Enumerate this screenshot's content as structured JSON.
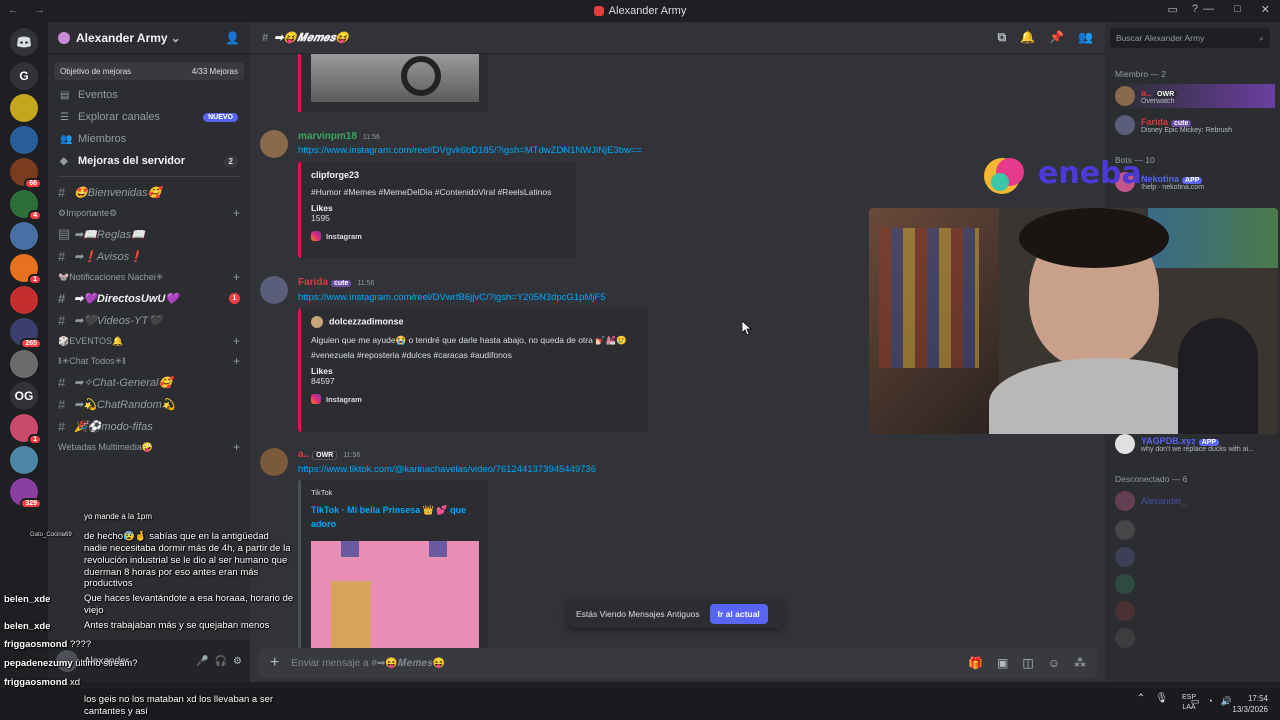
{
  "window": {
    "title": "Alexander Army"
  },
  "server": {
    "name": "Alexander Army",
    "boost_label": "Objetivo de mejoras",
    "boost_count": "4/33 Mejoras"
  },
  "nav": [
    {
      "icon": "calendar-icon",
      "label": "Eventos"
    },
    {
      "icon": "browse-icon",
      "label": "Explorar canales",
      "pill": "NUEVO"
    },
    {
      "icon": "members-icon",
      "label": "Miembros"
    },
    {
      "icon": "boost-icon",
      "label": "Mejoras del servidor",
      "count": "2"
    }
  ],
  "channels": {
    "bienvenidas": "🤩Bienvenidas🥰",
    "cat_importante": "⚙Importante⚙",
    "reglas": "➡📖Reglas📖",
    "avisos": "➡❗Avisos❗",
    "cat_notificaciones": "🐭Notificaciones Nachei✳",
    "directos": "➡💜DirectosUwU💜",
    "directos_badge": "1",
    "videos": "➡🖤Videos-YT🖤",
    "cat_eventos": "🎲EVENTOS🔔",
    "cat_chat": "‖✳Chat Todos✳‖",
    "chat_general": "➡✧Chat-General🥰",
    "chat_random": "➡💫ChatRandom💫",
    "modo_fifas": "🎉⚽modo-fifas",
    "cat_webadas": "Webadas Multimedia🤪"
  },
  "channel_header": "➡😝𝑴𝒆𝒎𝒆𝒔😝",
  "messages": [
    {
      "author": "marvinpm18",
      "time": "11:56",
      "link": "https://www.instagram.com/reel/DVgvk6bD185/?igsh=MTdwZDN1NWJlNjE3bw==",
      "embed_author": "clipforge23",
      "embed_text": "#Humor #Memes #MemeDelDia #ContenidoViral #ReelsLatinos",
      "likes_label": "Likes",
      "likes": "1595",
      "provider": "Instagram"
    },
    {
      "author": "Farida",
      "badge": "cute",
      "time": "11:56",
      "link": "https://www.instagram.com/reel/DVwrfB6jjvC/?igsh=Y205N3dpcG1pMjF5",
      "embed_author": "dolcezzadimonse",
      "embed_text": "Alguien que me ayude😭 o tendré que darle hasta abajo, no queda de otra 💅🏻💒🥲",
      "embed_text2": "#venezuela #reposteria #dulces #caracas #audifonos",
      "likes_label": "Likes",
      "likes": "84597",
      "provider": "Instagram"
    },
    {
      "author": "a..",
      "badge": "OWR",
      "time": "11:56",
      "link": "https://www.tiktok.com/@karinachavelas/video/7612441373945449736",
      "embed_author": "TikTok",
      "embed_title": "TikTok · Mi bella Prinsesa 👑 💕 que adoro"
    }
  ],
  "new_messages": {
    "text": "Estás Viendo Mensajes Antiguos",
    "button": "Ir al actual"
  },
  "composer": {
    "placeholder": "Enviar mensaje a #➡😝𝑴𝒆𝒎𝒆𝒔😝"
  },
  "members": {
    "search_placeholder": "Buscar Alexander Army",
    "online_header": "Miembro — 2",
    "online": [
      {
        "name": "a..",
        "tag": "OWR",
        "status": "Overwatch",
        "color": "#d83c3e"
      },
      {
        "name": "Farida",
        "tag": "cute",
        "status": "Disney Epic Mickey: Rebrush",
        "color": "#d83c3e"
      }
    ],
    "bots_header": "Bots — 10",
    "bots": [
      {
        "name": "Nekotina",
        "tag": "APP",
        "status": "!help · nekotina.com"
      },
      {
        "name": "YAGPDB.xyz",
        "tag": "APP",
        "status": "why don't we replace ducks with ai..."
      }
    ],
    "offline_header": "Desconectado — 6",
    "offline": [
      {
        "name": "Alexander_"
      }
    ]
  },
  "overlay_brand": "eneba",
  "stream_chat": [
    {
      "user": "",
      "text": "yo mande a la 1pm"
    },
    {
      "user": "Gato_Cocina69",
      "text": "de hecho😰🤞 sabías que en la antigüedad"
    },
    {
      "user": "",
      "text": "nadie necesitaba dormir más de 4h, a partir de la"
    },
    {
      "user": "",
      "text": "revolución industrial se le dio al ser humano que"
    },
    {
      "user": "",
      "text": "duerman 8 horas por eso antes eran más"
    },
    {
      "user": "",
      "text": "productivos"
    },
    {
      "user": "belen_xde",
      "text": "Que haces levantándote a esa horaaa, horario de"
    },
    {
      "user": "",
      "text": "viejo"
    },
    {
      "user": "belen_xde",
      "text": "Antes trabajaban más y se quejaban menos"
    },
    {
      "user": "friggaosmond",
      "text": "????"
    },
    {
      "user": "pepadenezumy",
      "text": "último stream?"
    },
    {
      "user": "friggaosmond",
      "text": "xd"
    },
    {
      "user": "",
      "text": "los geis no los mataban xd los llevaban a ser"
    },
    {
      "user": "",
      "text": "cantantes y así"
    }
  ],
  "user_panel": {
    "name": "Alexander"
  },
  "taskbar": {
    "lang": "ESP",
    "region": "LAA",
    "time": "17:54",
    "date": "13/3/2026"
  }
}
